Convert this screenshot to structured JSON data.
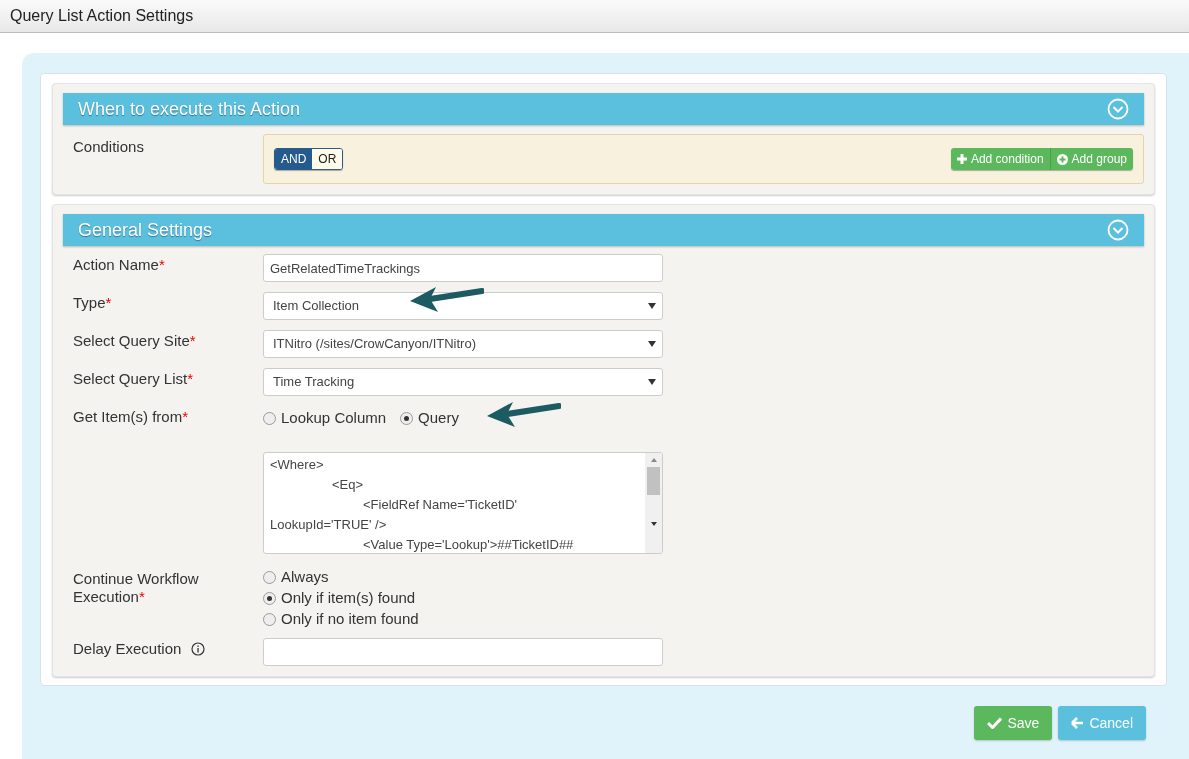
{
  "window": {
    "title": "Query List Action Settings"
  },
  "sections": [
    {
      "title": "When to execute this Action",
      "expanded": true
    },
    {
      "title": "General Settings",
      "expanded": true
    }
  ],
  "conditions": {
    "label": "Conditions",
    "operators": [
      {
        "label": "AND",
        "selected": true
      },
      {
        "label": "OR",
        "selected": false
      }
    ],
    "buttons": [
      {
        "label": "Add condition",
        "kind": "plus"
      },
      {
        "label": "Add group",
        "kind": "plus-circle"
      }
    ]
  },
  "fields": [
    {
      "kind": "text",
      "label": "Action Name",
      "required_mark": "*",
      "value": "GetRelatedTimeTrackings"
    },
    {
      "kind": "select",
      "label": "Type",
      "required_mark": "*",
      "value": "Item Collection",
      "annotated": true
    },
    {
      "kind": "select",
      "label": "Select Query Site",
      "required_mark": "*",
      "value": "ITNitro (/sites/CrowCanyon/ITNitro)"
    },
    {
      "kind": "select",
      "label": "Select Query List",
      "required_mark": "*",
      "value": "Time Tracking"
    },
    {
      "kind": "radio",
      "label": "Get Item(s) from",
      "required_mark": "*",
      "options": [
        {
          "label": "Lookup Column",
          "selected": false
        },
        {
          "label": "Query",
          "selected": true
        }
      ],
      "annotated": true
    },
    {
      "kind": "query",
      "value": "<Where>\n\t\t<Eq>\n\t\t\t<FieldRef Name='TicketID' LookupId='TRUE' />\n\t\t\t<Value Type='Lookup'>##TicketID##"
    },
    {
      "kind": "radio-stack",
      "label": "Continue Workflow Execution",
      "required_mark": "*",
      "options": [
        {
          "label": "Always",
          "selected": false
        },
        {
          "label": "Only if item(s) found",
          "selected": true
        },
        {
          "label": "Only if no item found",
          "selected": false
        }
      ]
    },
    {
      "kind": "text",
      "label": "Delay Execution",
      "info": true
    }
  ],
  "footer": [
    {
      "label": "Save",
      "kind": "save"
    },
    {
      "label": "Cancel",
      "kind": "cancel"
    }
  ]
}
